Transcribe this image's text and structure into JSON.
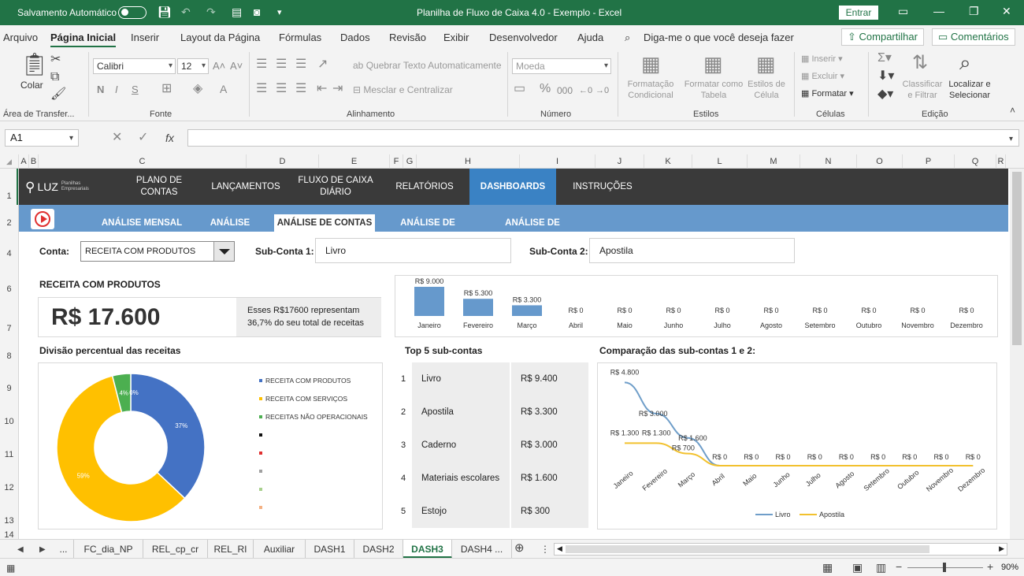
{
  "titlebar": {
    "autosave_label": "Salvamento Automático",
    "title": "Planilha de Fluxo de Caixa 4.0 - Exemplo  -  Excel",
    "signin_label": "Entrar"
  },
  "menu": {
    "items": [
      "Arquivo",
      "Página Inicial",
      "Inserir",
      "Layout da Página",
      "Fórmulas",
      "Dados",
      "Revisão",
      "Exibir",
      "Desenvolvedor",
      "Ajuda"
    ],
    "tell_me": "Diga-me o que você deseja fazer",
    "share_label": "Compartilhar",
    "comments_label": "Comentários"
  },
  "ribbon": {
    "clipboard": {
      "paste": "Colar",
      "label": "Área de Transfer..."
    },
    "font": {
      "name": "Calibri",
      "size": "12",
      "label": "Fonte"
    },
    "alignment": {
      "wrap": "Quebrar Texto Automaticamente",
      "merge": "Mesclar e Centralizar",
      "label": "Alinhamento"
    },
    "number": {
      "format": "Moeda",
      "label": "Número"
    },
    "styles": {
      "conditional": [
        "Formatação",
        "Condicional"
      ],
      "table": [
        "Formatar como",
        "Tabela"
      ],
      "cell": [
        "Estilos de",
        "Célula"
      ],
      "label": "Estilos"
    },
    "cells": {
      "insert": "Inserir",
      "delete": "Excluir",
      "format": "Formatar",
      "label": "Células"
    },
    "editing": {
      "sort": [
        "Classificar",
        "e Filtrar"
      ],
      "find": [
        "Localizar e",
        "Selecionar"
      ],
      "label": "Edição"
    }
  },
  "formula_bar": {
    "name_box": "A1",
    "formula": ""
  },
  "columns": [
    {
      "l": "A",
      "w": 13
    },
    {
      "l": "B",
      "w": 12
    },
    {
      "l": "C",
      "w": 264
    },
    {
      "l": "D",
      "w": 92
    },
    {
      "l": "E",
      "w": 90
    },
    {
      "l": "F",
      "w": 17
    },
    {
      "l": "G",
      "w": 17
    },
    {
      "l": "H",
      "w": 131
    },
    {
      "l": "I",
      "w": 96
    },
    {
      "l": "J",
      "w": 62
    },
    {
      "l": "K",
      "w": 61
    },
    {
      "l": "L",
      "w": 70
    },
    {
      "l": "M",
      "w": 67
    },
    {
      "l": "N",
      "w": 72
    },
    {
      "l": "O",
      "w": 58
    },
    {
      "l": "P",
      "w": 66
    },
    {
      "l": "Q",
      "w": 53
    },
    {
      "l": "R",
      "w": 12
    }
  ],
  "rows": [
    {
      "l": "1",
      "y": 36
    },
    {
      "l": "2",
      "y": 70
    },
    {
      "l": "4",
      "y": 109
    },
    {
      "l": "6",
      "y": 154
    },
    {
      "l": "7",
      "y": 204
    },
    {
      "l": "8",
      "y": 239
    },
    {
      "l": "9",
      "y": 280
    },
    {
      "l": "10",
      "y": 322
    },
    {
      "l": "11",
      "y": 364
    },
    {
      "l": "12",
      "y": 406
    },
    {
      "l": "13",
      "y": 448
    },
    {
      "l": "14",
      "y": 466
    }
  ],
  "nav": {
    "brand": "LUZ",
    "brand_sub": "Planilhas Empresariais",
    "items": [
      "PLANO DE CONTAS",
      "LANÇAMENTOS",
      "FLUXO DE CAIXA DIÁRIO",
      "RELATÓRIOS",
      "DASHBOARDS",
      "INSTRUÇÕES"
    ],
    "subitems": [
      "ANÁLISE MENSAL",
      "ANÁLISE ANUAL",
      "ANÁLISE DE CONTAS",
      "ANÁLISE DE RECEITAS",
      "ANÁLISE DE DESPESAS"
    ]
  },
  "filters": {
    "conta_label": "Conta:",
    "conta_value": "RECEITA COM PRODUTOS",
    "sub1_label": "Sub-Conta 1:",
    "sub1_value": "Livro",
    "sub2_label": "Sub-Conta 2:",
    "sub2_value": "Apostila"
  },
  "kpi": {
    "title": "RECEITA COM PRODUTOS",
    "value": "R$ 17.600",
    "note_line1": "Esses R$17600 representam",
    "note_line2": "36,7% do seu total de receitas"
  },
  "sections": {
    "donut": "Divisão percentual das receitas",
    "top5": "Top 5 sub-contas",
    "compare": "Comparação das sub-contas 1 e 2:"
  },
  "top5": [
    {
      "n": "1",
      "name": "Livro",
      "value": "R$ 9.400"
    },
    {
      "n": "2",
      "name": "Apostila",
      "value": "R$ 3.300"
    },
    {
      "n": "3",
      "name": "Caderno",
      "value": "R$ 3.000"
    },
    {
      "n": "4",
      "name": "Materiais escolares",
      "value": "R$ 1.600"
    },
    {
      "n": "5",
      "name": "Estojo",
      "value": "R$ 300"
    }
  ],
  "colors": {
    "ribbon_green": "#217346",
    "nav_dark": "#3a3a3a",
    "nav_blue": "#6699cc",
    "bar": "#6699cc",
    "livro": "#6f9ec9",
    "apostila": "#f2c12e",
    "donut_blue": "#4472c4",
    "donut_yellow": "#ffc000",
    "donut_green": "#4caf50"
  },
  "chart_data": [
    {
      "type": "bar",
      "categories": [
        "Janeiro",
        "Fevereiro",
        "Março",
        "Abril",
        "Maio",
        "Junho",
        "Julho",
        "Agosto",
        "Setembro",
        "Outubro",
        "Novembro",
        "Dezembro"
      ],
      "values": [
        9000,
        5300,
        3300,
        0,
        0,
        0,
        0,
        0,
        0,
        0,
        0,
        0
      ],
      "labels": [
        "R$ 9.000",
        "R$ 5.300",
        "R$ 3.300",
        "R$ 0",
        "R$ 0",
        "R$ 0",
        "R$ 0",
        "R$ 0",
        "R$ 0",
        "R$ 0",
        "R$ 0",
        "R$ 0"
      ],
      "ylim": [
        0,
        9000
      ]
    },
    {
      "type": "pie",
      "categories": [
        "RECEITA COM PRODUTOS",
        "RECEITA COM SERVIÇOS",
        "RECEITAS NÃO OPERACIONAIS",
        "",
        "",
        "",
        "",
        ""
      ],
      "legend_colors": [
        "#4472c4",
        "#ffc000",
        "#4caf50",
        "#111111",
        "#e03030",
        "#a0a0a0",
        "#a8d08d",
        "#f4b183"
      ],
      "values": [
        37,
        59,
        4,
        0
      ],
      "slice_colors": [
        "#4472c4",
        "#ffc000",
        "#4caf50",
        "#e03030"
      ],
      "labels": [
        "37%",
        "59%",
        "4%",
        "0%"
      ],
      "legend": "right"
    },
    {
      "type": "line",
      "x": [
        "Janeiro",
        "Fevereiro",
        "Março",
        "Abril",
        "Maio",
        "Junho",
        "Julho",
        "Agosto",
        "Setembro",
        "Outubro",
        "Novembro",
        "Dezembro"
      ],
      "series": [
        {
          "name": "Livro",
          "values": [
            4800,
            3000,
            1600,
            0,
            0,
            0,
            0,
            0,
            0,
            0,
            0,
            0
          ],
          "labels": [
            "R$ 4.800",
            "R$ 3.000",
            "R$ 1.600",
            "R$ 0",
            "R$ 0",
            "R$ 0",
            "R$ 0",
            "R$ 0",
            "R$ 0",
            "R$ 0",
            "R$ 0",
            "R$ 0"
          ]
        },
        {
          "name": "Apostila",
          "values": [
            1300,
            1300,
            700,
            0,
            0,
            0,
            0,
            0,
            0,
            0,
            0,
            0
          ],
          "labels": [
            "R$ 1.300",
            "R$ 1.300",
            "R$ 700",
            "",
            "",
            "",
            "",
            "",
            "",
            "",
            "",
            ""
          ]
        }
      ],
      "legend": "bottom",
      "ylim": [
        0,
        5000
      ]
    }
  ],
  "sheet_tabs": [
    "...",
    "FC_dia_NP",
    "REL_cp_cr",
    "REL_RI",
    "Auxiliar",
    "DASH1",
    "DASH2",
    "DASH3",
    "DASH4 ..."
  ],
  "active_tab": "DASH3",
  "status": {
    "zoom": "90%"
  }
}
